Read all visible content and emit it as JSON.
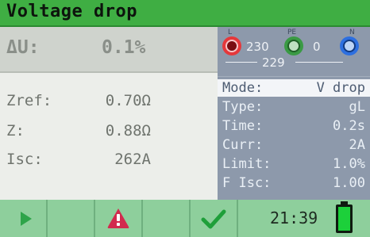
{
  "title": "Voltage drop",
  "result": {
    "du_label": "ΔU:",
    "du_value": "0.1%"
  },
  "measurements": [
    {
      "label": "Zref:",
      "value": "0.70Ω"
    },
    {
      "label": "Z:",
      "value": "0.88Ω"
    },
    {
      "label": "Isc:",
      "value": "262A"
    }
  ],
  "terminals": {
    "l_label": "L",
    "pe_label": "PE",
    "n_label": "N",
    "l_pe_voltage": "230",
    "pe_n_voltage": "0",
    "l_n_voltage": "229",
    "colors": {
      "l": "#e5383b",
      "pe": "#3a9a44",
      "n": "#2d6fe0"
    }
  },
  "parameters": [
    {
      "label": "Mode:",
      "value": "V drop"
    },
    {
      "label": "Type:",
      "value": "gL"
    },
    {
      "label": "Time:",
      "value": "0.2s"
    },
    {
      "label": "Curr:",
      "value": "2A"
    },
    {
      "label": "Limit:",
      "value": "1.0%"
    },
    {
      "label": "F Isc:",
      "value": "1.00"
    }
  ],
  "status": {
    "time": "21:39",
    "battery_level": 1.0,
    "icons": [
      "play-icon",
      "warning-icon",
      "check-icon",
      "battery-icon"
    ]
  },
  "colors": {
    "title_bar": "#3fae43",
    "bottom_bar": "#8ecf9c",
    "panel": "#8d99ab",
    "warning": "#d22a4e",
    "check": "#1f9f3a",
    "play": "#2ea44a"
  }
}
